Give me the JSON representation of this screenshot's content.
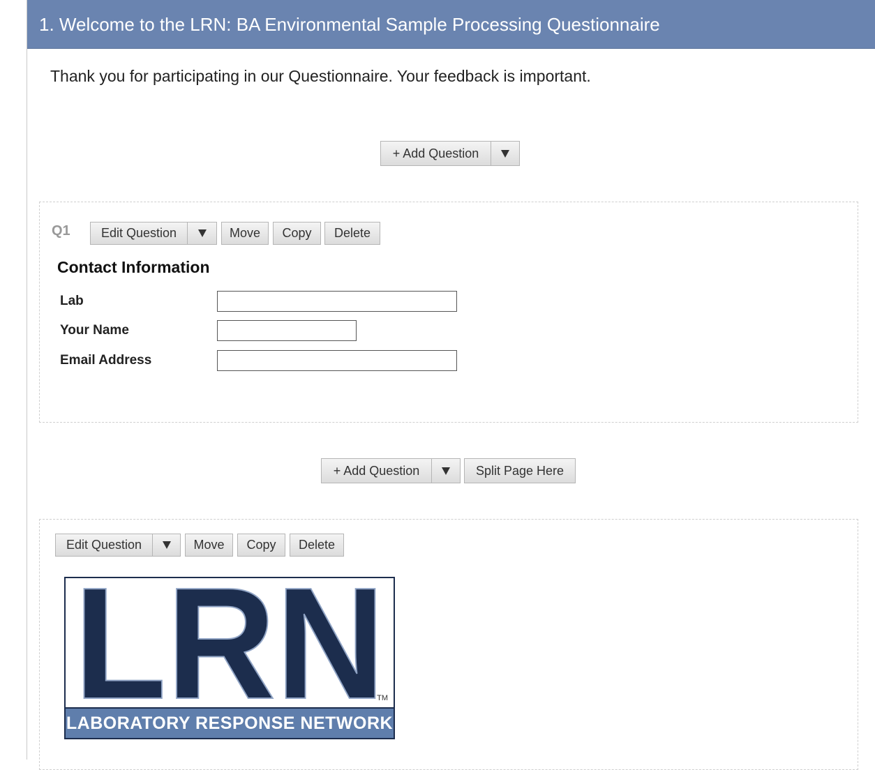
{
  "header": {
    "title": "1. Welcome to the LRN: BA Environmental Sample Processing Questionnaire"
  },
  "intro": {
    "text": "Thank you for participating in our Questionnaire. Your feedback is important."
  },
  "toolbar_top": {
    "add_question_label": "+ Add Question"
  },
  "question1": {
    "number": "Q1",
    "edit_label": "Edit Question",
    "move_label": "Move",
    "copy_label": "Copy",
    "delete_label": "Delete",
    "section_title": "Contact Information",
    "fields": [
      {
        "label": "Lab",
        "value": ""
      },
      {
        "label": "Your Name",
        "value": ""
      },
      {
        "label": "Email Address",
        "value": ""
      }
    ]
  },
  "toolbar_middle": {
    "add_question_label": "+ Add Question",
    "split_page_label": "Split Page Here"
  },
  "question2": {
    "edit_label": "Edit Question",
    "move_label": "Move",
    "copy_label": "Copy",
    "delete_label": "Delete",
    "logo": {
      "letters": "LRN",
      "trademark": "TM",
      "band_text": "LABORATORY RESPONSE NETWORK"
    }
  },
  "colors": {
    "header_bg": "#6a84b0",
    "logo_navy": "#1c2d4d",
    "logo_band": "#5f7eac"
  }
}
